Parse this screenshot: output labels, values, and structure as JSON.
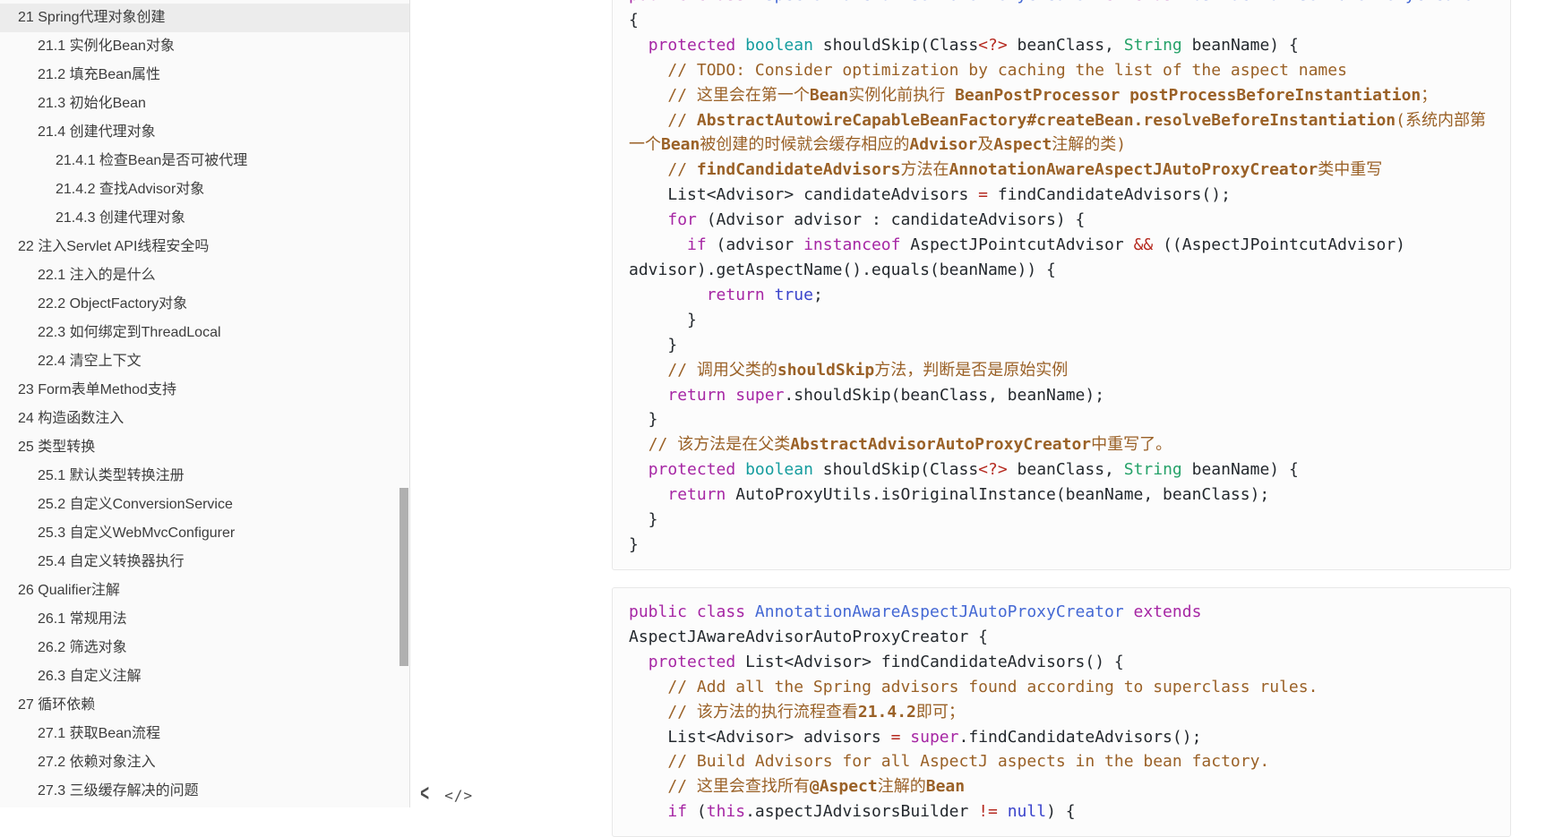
{
  "palette": {
    "keyword": "#a626a4",
    "type": "#149c9e",
    "type_green": "#26a269",
    "title": "#4468d4",
    "literal": "#3a43cb",
    "operator": "#b5291f",
    "comment": "#9a6127",
    "plain": "#24292e",
    "sidebar_active_bg": "#ececec",
    "sidebar_bg": "#fafafa",
    "code_box_bg": "#fcfcfc",
    "code_box_border": "#e8e8e8",
    "scrollbar_thumb": "#b0b0b0"
  },
  "sidebar": {
    "items": [
      {
        "label": "21 Spring代理对象创建",
        "level": 1,
        "active": true
      },
      {
        "label": "21.1 实例化Bean对象",
        "level": 2,
        "active": false
      },
      {
        "label": "21.2 填充Bean属性",
        "level": 2,
        "active": false
      },
      {
        "label": "21.3 初始化Bean",
        "level": 2,
        "active": false
      },
      {
        "label": "21.4 创建代理对象",
        "level": 2,
        "active": false
      },
      {
        "label": "21.4.1 检查Bean是否可被代理",
        "level": 3,
        "active": false
      },
      {
        "label": "21.4.2 查找Advisor对象",
        "level": 3,
        "active": false
      },
      {
        "label": "21.4.3 创建代理对象",
        "level": 3,
        "active": false
      },
      {
        "label": "22 注入Servlet API线程安全吗",
        "level": 1,
        "active": false
      },
      {
        "label": "22.1 注入的是什么",
        "level": 2,
        "active": false
      },
      {
        "label": "22.2 ObjectFactory对象",
        "level": 2,
        "active": false
      },
      {
        "label": "22.3 如何绑定到ThreadLocal",
        "level": 2,
        "active": false
      },
      {
        "label": "22.4 清空上下文",
        "level": 2,
        "active": false
      },
      {
        "label": "23 Form表单Method支持",
        "level": 1,
        "active": false
      },
      {
        "label": "24 构造函数注入",
        "level": 1,
        "active": false
      },
      {
        "label": "25 类型转换",
        "level": 1,
        "active": false
      },
      {
        "label": "25.1 默认类型转换注册",
        "level": 2,
        "active": false
      },
      {
        "label": "25.2 自定义ConversionService",
        "level": 2,
        "active": false
      },
      {
        "label": "25.3 自定义WebMvcConfigurer",
        "level": 2,
        "active": false
      },
      {
        "label": "25.4 自定义转换器执行",
        "level": 2,
        "active": false
      },
      {
        "label": "26 Qualifier注解",
        "level": 1,
        "active": false
      },
      {
        "label": "26.1 常规用法",
        "level": 2,
        "active": false
      },
      {
        "label": "26.2 筛选对象",
        "level": 2,
        "active": false
      },
      {
        "label": "26.3 自定义注解",
        "level": 2,
        "active": false
      },
      {
        "label": "27 循环依赖",
        "level": 1,
        "active": false
      },
      {
        "label": "27.1 获取Bean流程",
        "level": 2,
        "active": false
      },
      {
        "label": "27.2 依赖对象注入",
        "level": 2,
        "active": false
      },
      {
        "label": "27.3 三级缓存解决的问题",
        "level": 2,
        "active": false
      }
    ]
  },
  "footer": {
    "back_glyph": "<",
    "code_glyph": "</>"
  },
  "code_blocks": [
    {
      "lines": [
        [
          {
            "t": "public class ",
            "c": "keyword"
          },
          {
            "t": "AspectJAwareAdvisorAutoProxyCreator",
            "c": "title"
          },
          {
            "t": " "
          },
          {
            "t": "extends",
            "c": "keyword"
          },
          {
            "t": " "
          },
          {
            "t": "AbstractAdvisorAutoProxyCreator",
            "c": "title"
          }
        ],
        [
          {
            "t": "{"
          }
        ],
        [
          {
            "t": "  "
          },
          {
            "t": "protected",
            "c": "keyword"
          },
          {
            "t": " "
          },
          {
            "t": "boolean",
            "c": "type"
          },
          {
            "t": " shouldSkip(Class"
          },
          {
            "t": "<?>",
            "c": "operator"
          },
          {
            "t": " beanClass, "
          },
          {
            "t": "String",
            "c": "type_green"
          },
          {
            "t": " beanName) {"
          }
        ],
        [
          {
            "t": "    "
          },
          {
            "t": "// TODO: Consider optimization by caching the list of the aspect names",
            "c": "comment"
          }
        ],
        [
          {
            "t": "    "
          },
          {
            "t": "// 这里会在第一个",
            "c": "comment"
          },
          {
            "t": "Bean",
            "c": "comment",
            "b": true
          },
          {
            "t": "实例化前执行 ",
            "c": "comment"
          },
          {
            "t": "BeanPostProcessor postProcessBeforeInstantiation",
            "c": "comment",
            "b": true
          },
          {
            "t": "；",
            "c": "comment"
          }
        ],
        [
          {
            "t": "    "
          },
          {
            "t": "// ",
            "c": "comment"
          },
          {
            "t": "AbstractAutowireCapableBeanFactory#createBean.resolveBeforeInstantiation",
            "c": "comment",
            "b": true
          },
          {
            "t": "(系统内部第",
            "c": "comment"
          }
        ],
        [
          {
            "t": "一个",
            "c": "comment"
          },
          {
            "t": "Bean",
            "c": "comment",
            "b": true
          },
          {
            "t": "被创建的时候就会缓存相应的",
            "c": "comment"
          },
          {
            "t": "Advisor",
            "c": "comment",
            "b": true
          },
          {
            "t": "及",
            "c": "comment"
          },
          {
            "t": "Aspect",
            "c": "comment",
            "b": true
          },
          {
            "t": "注解的类)",
            "c": "comment"
          }
        ],
        [
          {
            "t": "    "
          },
          {
            "t": "// ",
            "c": "comment"
          },
          {
            "t": "findCandidateAdvisors",
            "c": "comment",
            "b": true
          },
          {
            "t": "方法在",
            "c": "comment"
          },
          {
            "t": "AnnotationAwareAspectJAutoProxyCreator",
            "c": "comment",
            "b": true
          },
          {
            "t": "类中重写",
            "c": "comment"
          }
        ],
        [
          {
            "t": "    List<Advisor> candidateAdvisors "
          },
          {
            "t": "=",
            "c": "operator"
          },
          {
            "t": " findCandidateAdvisors();"
          }
        ],
        [
          {
            "t": "    "
          },
          {
            "t": "for",
            "c": "keyword"
          },
          {
            "t": " (Advisor advisor : candidateAdvisors) {"
          }
        ],
        [
          {
            "t": "      "
          },
          {
            "t": "if",
            "c": "keyword"
          },
          {
            "t": " (advisor "
          },
          {
            "t": "instanceof",
            "c": "keyword"
          },
          {
            "t": " AspectJPointcutAdvisor "
          },
          {
            "t": "&&",
            "c": "operator"
          },
          {
            "t": " ((AspectJPointcutAdvisor)"
          }
        ],
        [
          {
            "t": "advisor).getAspectName().equals(beanName)) {"
          }
        ],
        [
          {
            "t": "        "
          },
          {
            "t": "return",
            "c": "keyword"
          },
          {
            "t": " "
          },
          {
            "t": "true",
            "c": "literal"
          },
          {
            "t": ";"
          }
        ],
        [
          {
            "t": "      }"
          }
        ],
        [
          {
            "t": "    }"
          }
        ],
        [
          {
            "t": "    "
          },
          {
            "t": "// 调用父类的",
            "c": "comment"
          },
          {
            "t": "shouldSkip",
            "c": "comment",
            "b": true
          },
          {
            "t": "方法，判断是否是原始实例",
            "c": "comment"
          }
        ],
        [
          {
            "t": "    "
          },
          {
            "t": "return",
            "c": "keyword"
          },
          {
            "t": " "
          },
          {
            "t": "super",
            "c": "keyword"
          },
          {
            "t": ".shouldSkip(beanClass, beanName);"
          }
        ],
        [
          {
            "t": "  }"
          }
        ],
        [
          {
            "t": "  "
          },
          {
            "t": "// 该方法是在父类",
            "c": "comment"
          },
          {
            "t": "AbstractAdvisorAutoProxyCreator",
            "c": "comment",
            "b": true
          },
          {
            "t": "中重写了。",
            "c": "comment"
          }
        ],
        [
          {
            "t": "  "
          },
          {
            "t": "protected",
            "c": "keyword"
          },
          {
            "t": " "
          },
          {
            "t": "boolean",
            "c": "type"
          },
          {
            "t": " shouldSkip(Class"
          },
          {
            "t": "<?>",
            "c": "operator"
          },
          {
            "t": " beanClass, "
          },
          {
            "t": "String",
            "c": "type_green"
          },
          {
            "t": " beanName) {"
          }
        ],
        [
          {
            "t": "    "
          },
          {
            "t": "return",
            "c": "keyword"
          },
          {
            "t": " AutoProxyUtils.isOriginalInstance(beanName, beanClass);"
          }
        ],
        [
          {
            "t": "  }"
          }
        ],
        [
          {
            "t": "}"
          }
        ]
      ]
    },
    {
      "lines": [
        [
          {
            "t": "public class ",
            "c": "keyword"
          },
          {
            "t": "AnnotationAwareAspectJAutoProxyCreator",
            "c": "title"
          },
          {
            "t": " "
          },
          {
            "t": "extends",
            "c": "keyword"
          }
        ],
        [
          {
            "t": "AspectJAwareAdvisorAutoProxyCreator {"
          }
        ],
        [
          {
            "t": "  "
          },
          {
            "t": "protected",
            "c": "keyword"
          },
          {
            "t": " List<Advisor> findCandidateAdvisors() {"
          }
        ],
        [
          {
            "t": "    "
          },
          {
            "t": "// Add all the Spring advisors found according to superclass rules.",
            "c": "comment"
          }
        ],
        [
          {
            "t": "    "
          },
          {
            "t": "// 该方法的执行流程查看",
            "c": "comment"
          },
          {
            "t": "21.4.2",
            "c": "comment",
            "b": true
          },
          {
            "t": "即可；",
            "c": "comment"
          }
        ],
        [
          {
            "t": "    List<Advisor> advisors "
          },
          {
            "t": "=",
            "c": "operator"
          },
          {
            "t": " "
          },
          {
            "t": "super",
            "c": "keyword"
          },
          {
            "t": ".findCandidateAdvisors();"
          }
        ],
        [
          {
            "t": "    "
          },
          {
            "t": "// Build Advisors for all AspectJ aspects in the bean factory.",
            "c": "comment"
          }
        ],
        [
          {
            "t": "    "
          },
          {
            "t": "// 这里会查找所有",
            "c": "comment"
          },
          {
            "t": "@Aspect",
            "c": "comment",
            "b": true
          },
          {
            "t": "注解的",
            "c": "comment"
          },
          {
            "t": "Bean",
            "c": "comment",
            "b": true
          }
        ],
        [
          {
            "t": "    "
          },
          {
            "t": "if",
            "c": "keyword"
          },
          {
            "t": " ("
          },
          {
            "t": "this",
            "c": "keyword"
          },
          {
            "t": ".aspectJAdvisorsBuilder "
          },
          {
            "t": "!=",
            "c": "operator"
          },
          {
            "t": " "
          },
          {
            "t": "null",
            "c": "literal"
          },
          {
            "t": ") {"
          }
        ]
      ]
    }
  ]
}
